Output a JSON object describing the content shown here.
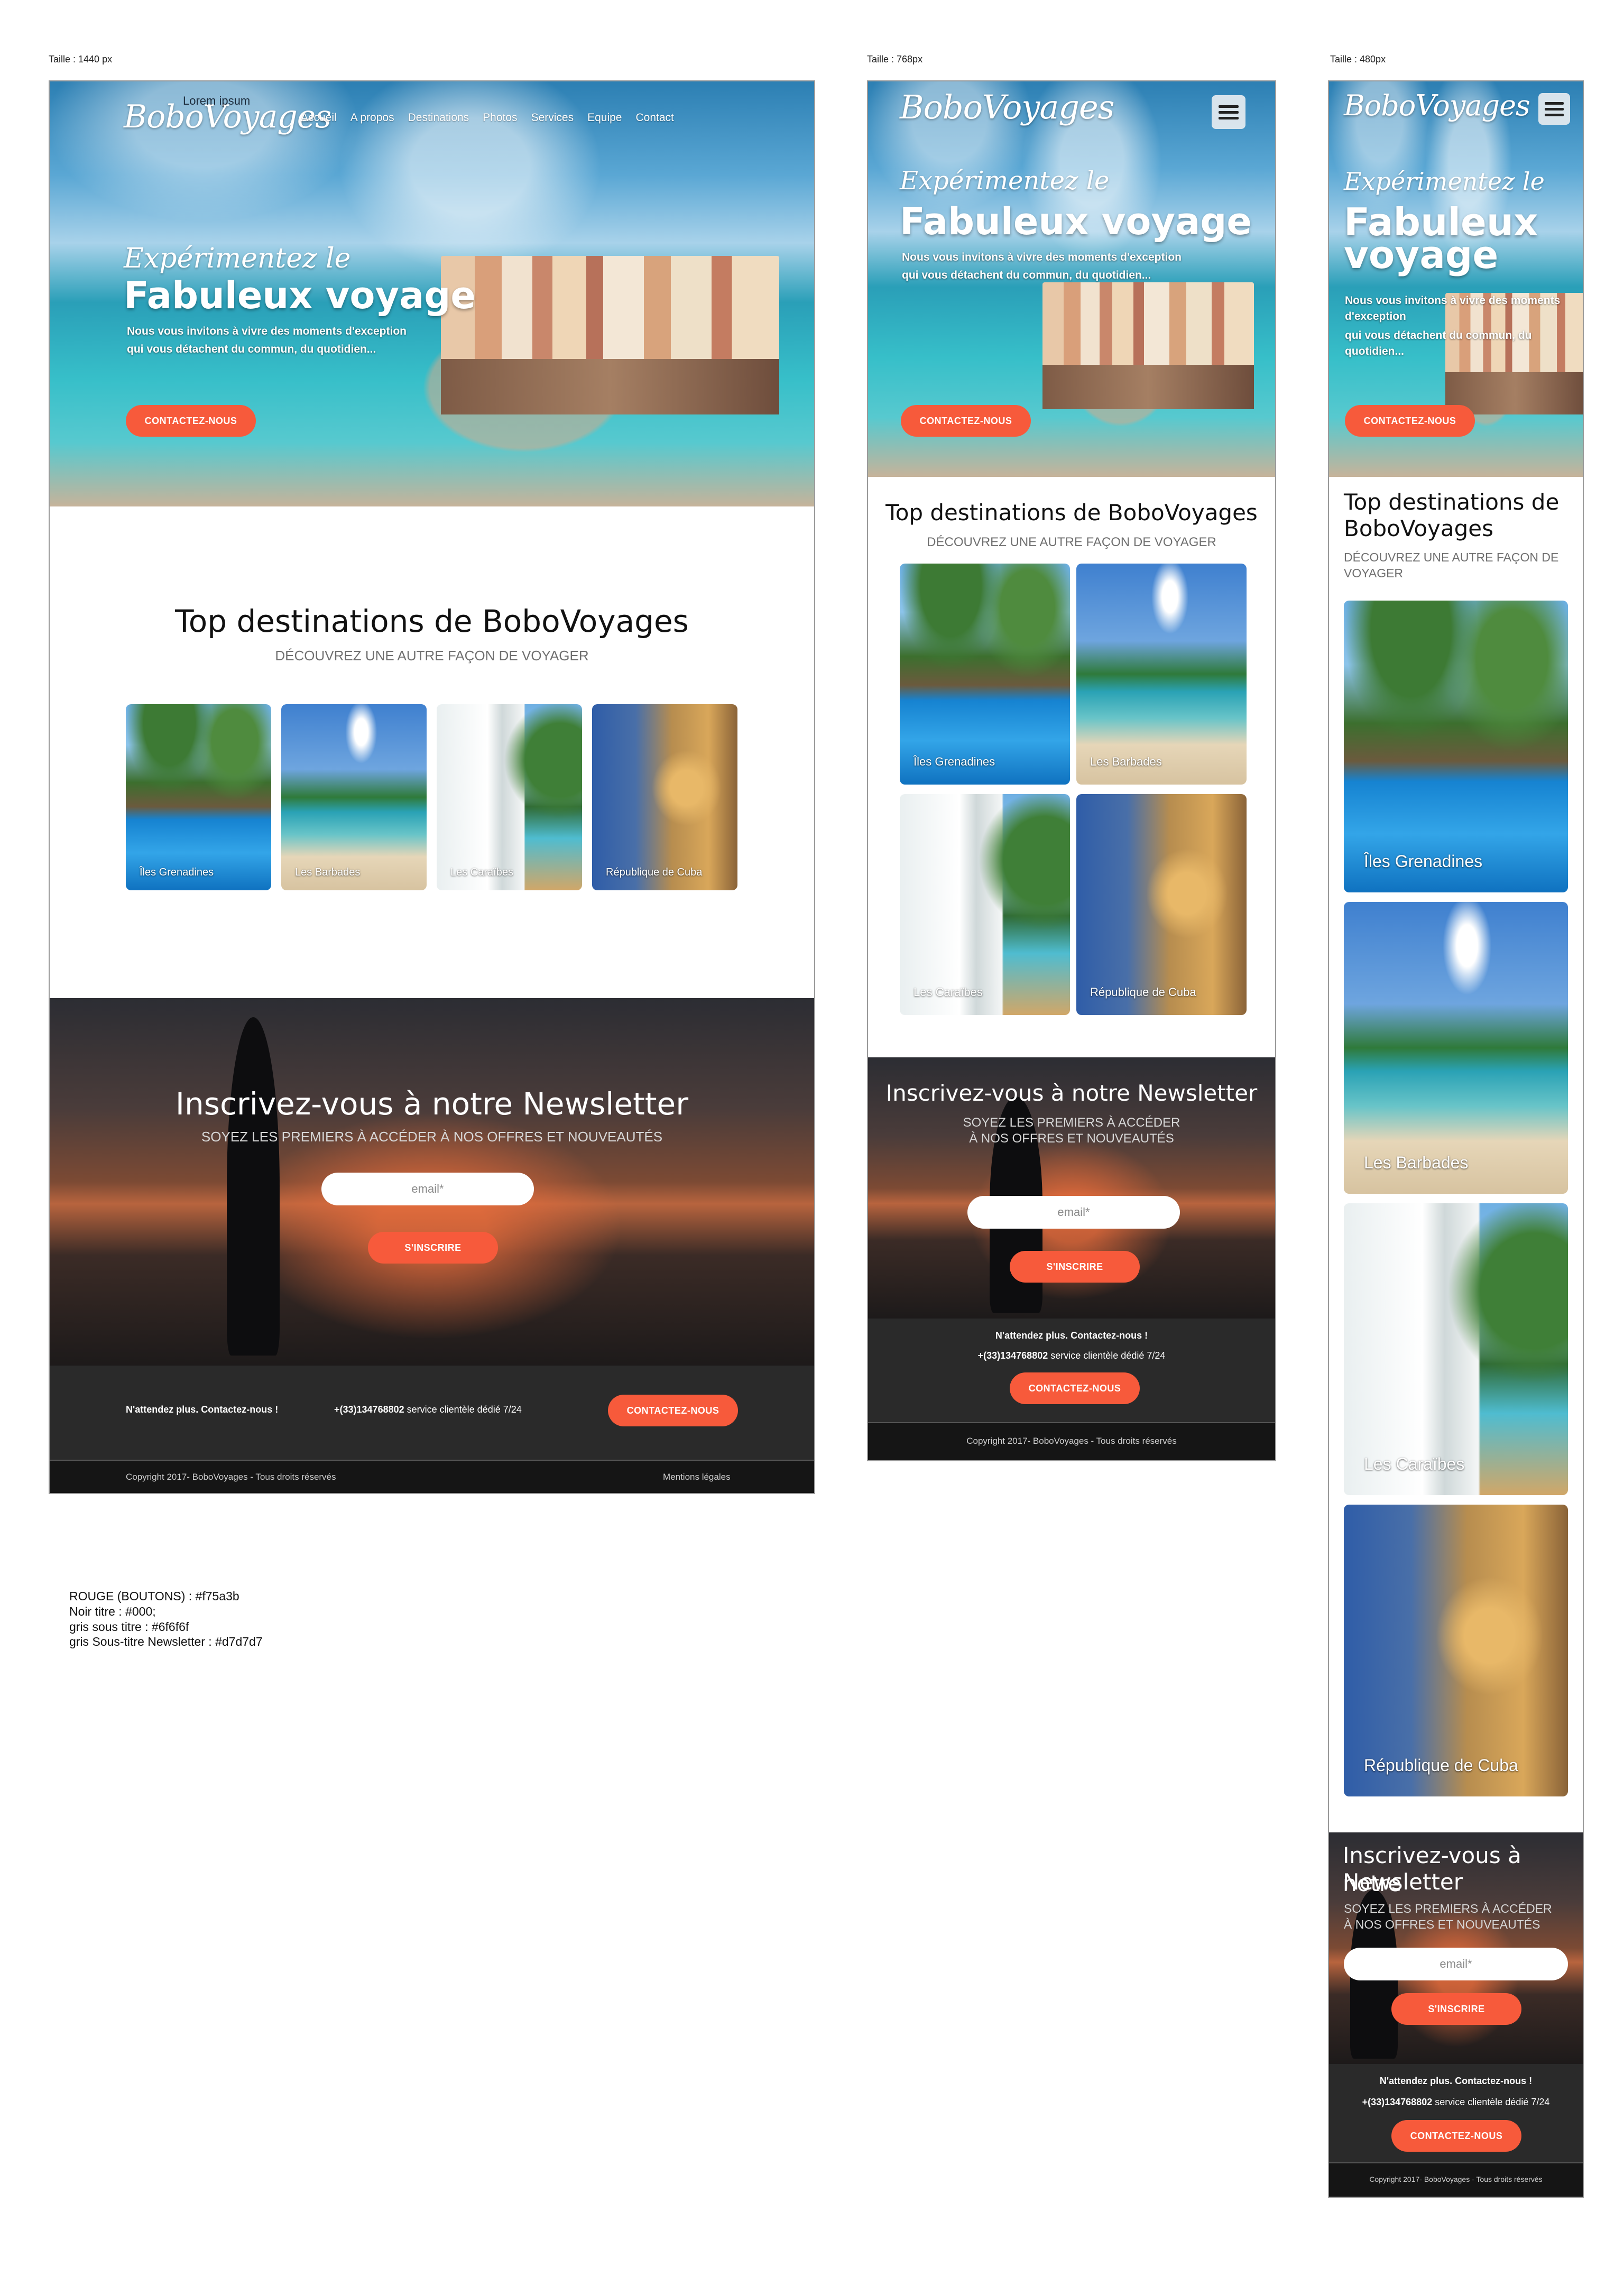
{
  "labels": {
    "desktop": "Taille : 1440 px",
    "tablet": "Taille : 768px",
    "mobile": "Taille : 480px"
  },
  "brand": {
    "logo": "BoboVoyages",
    "tagline": "Lorem ipsum"
  },
  "nav": [
    "Accueil",
    "A propos",
    "Destinations",
    "Photos",
    "Services",
    "Equipe",
    "Contact"
  ],
  "hero": {
    "script": "Expérimentez le",
    "title": "Fabuleux voyage",
    "title_m1": "Fabuleux",
    "title_m2": "voyage",
    "lead1": "Nous vous invitons à vivre des moments d'exception",
    "lead2": "qui vous détachent du commun, du quotidien...",
    "button": "CONTACTEZ-NOUS"
  },
  "destinations": {
    "title": "Top destinations de BoboVoyages",
    "title_m1": "Top destinations de",
    "title_m2": "BoboVoyages",
    "subtitle": "DÉCOUVREZ UNE AUTRE FAÇON DE VOYAGER",
    "sub_m1": "DÉCOUVREZ UNE AUTRE FAÇON DE",
    "sub_m2": "VOYAGER",
    "items": [
      "Îles Grenadines",
      "Les Barbades",
      "Les Caraïbes",
      "République de Cuba"
    ]
  },
  "newsletter": {
    "title": "Inscrivez-vous à notre Newsletter",
    "title_m1": "Inscrivez-vous à notre",
    "title_m2": "Newsletter",
    "subtitle": "SOYEZ LES PREMIERS À ACCÉDER À NOS OFFRES ET NOUVEAUTÉS",
    "sub_t1": "SOYEZ LES PREMIERS À ACCÉDER",
    "sub_t2": "À NOS OFFRES ET NOUVEAUTÉS",
    "email_placeholder": "email*",
    "button": "S'INSCRIRE"
  },
  "footer": {
    "cta": "N'attendez plus. Contactez-nous !",
    "phone": "+(33)134768802",
    "phone_note": " service clientèle dédié 7/24",
    "button": "CONTACTEZ-NOUS",
    "copyright": "Copyright 2017- BoboVoyages - Tous droits réservés",
    "legal": "Mentions légales"
  },
  "notes": [
    "ROUGE (BOUTONS) : #f75a3b",
    "Noir titre : #000;",
    "gris sous titre : #6f6f6f",
    "gris Sous-titre Newsletter : #d7d7d7"
  ],
  "colors": {
    "button": "#f75a3b",
    "title": "#000",
    "subtitle": "#6f6f6f",
    "newsletter_subtitle": "#d7d7d7"
  }
}
